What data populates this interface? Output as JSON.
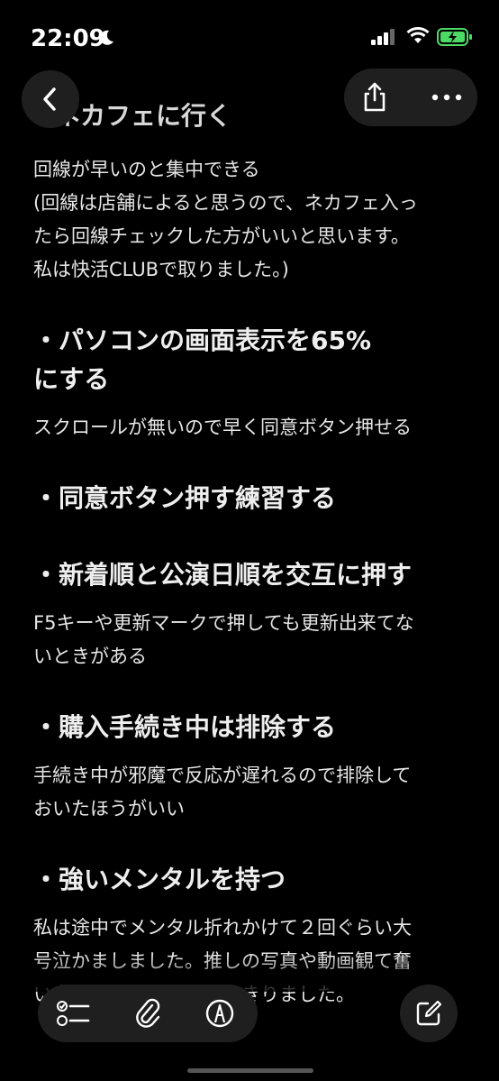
{
  "status_bar": {
    "time": "22:09",
    "battery_color": "#4cd964",
    "icons": [
      "moon-icon",
      "signal-icon",
      "wifi-icon",
      "battery-charging-icon"
    ]
  },
  "toolbar_top": {
    "icons": [
      "back-chevron-icon",
      "share-icon",
      "more-icon"
    ]
  },
  "note": {
    "first_heading": "ネカフェに行く",
    "sections": [
      {
        "body": "回線が早いのと集中できる\n(回線は店舗によると思うので、ネカフェ入っ\nたら回線チェックした方がいいと思います。\n私は快活CLUBで取りました。)"
      },
      {
        "heading": "・パソコンの画面表示を65%\nにする",
        "body": "スクロールが無いので早く同意ボタン押せる"
      },
      {
        "heading": "・同意ボタン押す練習する",
        "body": ""
      },
      {
        "heading": "・新着順と公演日順を交互に押す",
        "body": "F5キーや更新マークで押しても更新出来てな\nいときがある"
      },
      {
        "heading": "・購入手続き中は排除する",
        "body": "手続き中が邪魔で反応が遅れるので排除して\nおいたほうがいい"
      },
      {
        "heading": "・強いメンタルを持つ",
        "body": "私は途中でメンタル折れかけて２回ぐらい大\n号泣かましました。推しの写真や動画観て奮\nい立たせてなんとかやりきりました。"
      }
    ]
  },
  "toolbar_bottom": {
    "icons": [
      "checklist-icon",
      "paperclip-icon",
      "markup-pen-icon",
      "compose-icon"
    ]
  }
}
